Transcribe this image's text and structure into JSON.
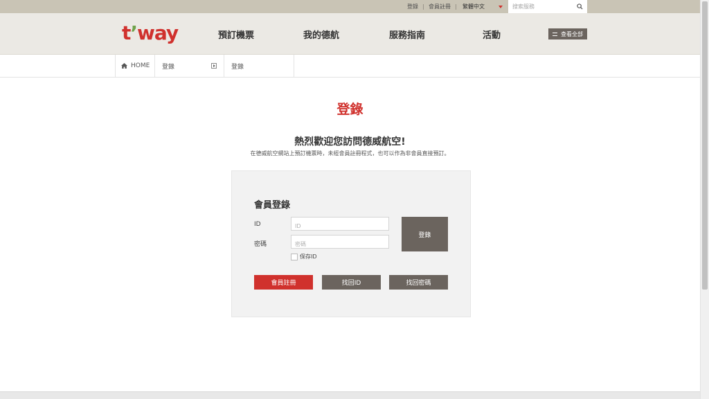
{
  "util": {
    "login": "登錄",
    "register": "會員註冊",
    "language": "繁體中文",
    "search_placeholder": "搜索服務"
  },
  "header": {
    "logo": "t’way",
    "nav": [
      "預訂機票",
      "我的德航",
      "服務指南",
      "活動"
    ],
    "view_all": "查看全部"
  },
  "breadcrumb": {
    "home": "HOME",
    "level1": "登錄",
    "level2": "登錄"
  },
  "main": {
    "title": "登錄",
    "welcome": "熱烈歡迎您訪問德威航空!",
    "description": "在德威航空網站上預訂機票時，未經會員註冊程式，也可以作為非會員直接預訂。"
  },
  "login_panel": {
    "title": "會員登錄",
    "id_label": "ID",
    "id_placeholder": "ID",
    "password_label": "密碼",
    "password_placeholder": "密碼",
    "login_button": "登錄",
    "save_id": "保存ID",
    "register_button": "會員註冊",
    "find_id_button": "找回ID",
    "find_password_button": "找回密碼"
  },
  "colors": {
    "brand_red": "#d0312d",
    "brand_green": "#6fa24a",
    "button_grey": "#6b645e",
    "util_bar": "#c9c4b5",
    "header_bg": "#ebe9e4"
  }
}
